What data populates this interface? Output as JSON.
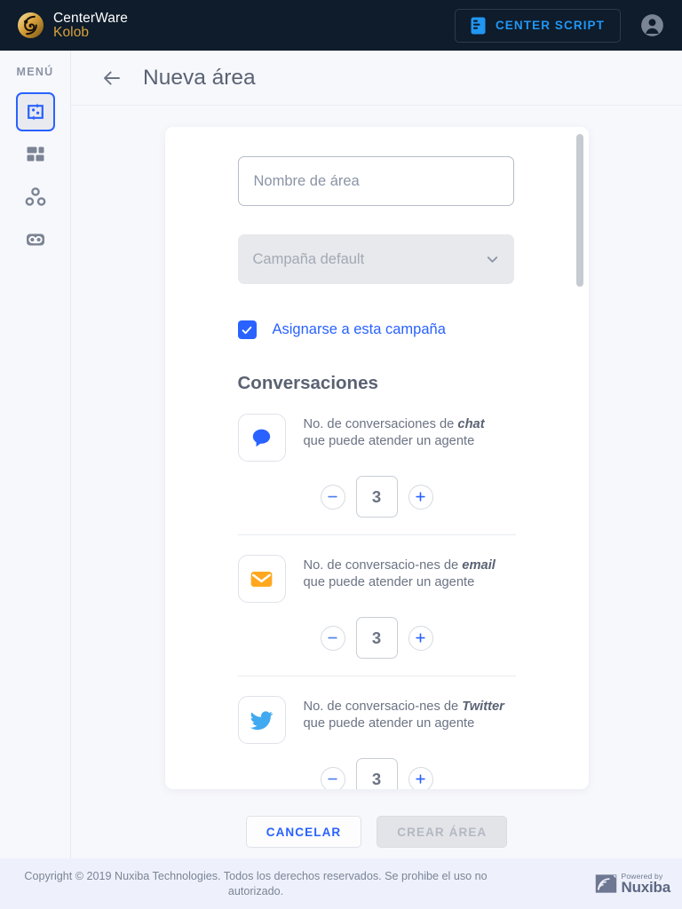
{
  "topbar": {
    "brand_line1": "CenterWare",
    "brand_line2": "Kolob",
    "brand_icon": "centerware-swirl-logo",
    "script_button_label": "CENTER SCRIPT",
    "script_button_icon": "script-document-icon",
    "avatar_icon": "user-account-icon",
    "background": "#0e1c2b",
    "accent": "#2196f3"
  },
  "sidebar": {
    "menu_label": "MENÚ",
    "items": [
      {
        "name": "areas",
        "icon": "area-exchange-icon",
        "active": true
      },
      {
        "name": "dashboard",
        "icon": "grid-dashboard-icon",
        "active": false
      },
      {
        "name": "nodes",
        "icon": "nodes-hierarchy-icon",
        "active": false
      },
      {
        "name": "voicemail",
        "icon": "voicemail-icon",
        "active": false
      }
    ],
    "active_color": "#2962ff"
  },
  "page": {
    "back_icon": "arrow-left-icon",
    "title": "Nueva área"
  },
  "form": {
    "name_field": {
      "value": "",
      "placeholder": "Nombre de área"
    },
    "campaign_select": {
      "value": "Campaña default",
      "caret_icon": "chevron-down-icon",
      "disabled": true
    },
    "assign_checkbox": {
      "label": "Asignarse a esta campaña",
      "checked": true,
      "icon": "check-icon",
      "color": "#2962ff"
    },
    "section_title": "Conversaciones",
    "conversations": [
      {
        "icon": "chat-bubble-icon",
        "icon_color": "#2962ff",
        "text_prefix": "No. de conversaciones de ",
        "channel": "chat",
        "text_suffix": "que puede atender un agente",
        "value": "3",
        "decrement_icon": "minus-icon",
        "increment_icon": "plus-icon"
      },
      {
        "icon": "envelope-icon",
        "icon_color": "#ffa81f",
        "text_prefix": "No. de conversacio-nes de ",
        "channel": "email",
        "text_suffix": "que puede atender un agente",
        "value": "3",
        "decrement_icon": "minus-icon",
        "increment_icon": "plus-icon"
      },
      {
        "icon": "twitter-bird-icon",
        "icon_color": "#40a9f0",
        "text_prefix": "No. de conversacio-nes de ",
        "channel": "Twitter",
        "text_suffix": "que puede atender un agente",
        "value": "3",
        "decrement_icon": "minus-icon",
        "increment_icon": "plus-icon"
      }
    ]
  },
  "actions": {
    "cancel_label": "CANCELAR",
    "create_label": "CREAR ÁREA",
    "create_disabled": true
  },
  "footer": {
    "copyright": "Copyright © 2019 Nuxiba Technologies. Todos los derechos reservados. Se prohibe el uso no autorizado.",
    "powered_small": "Powered by",
    "powered_big": "Nuxiba",
    "logo_icon": "nuxiba-swoosh-icon"
  }
}
